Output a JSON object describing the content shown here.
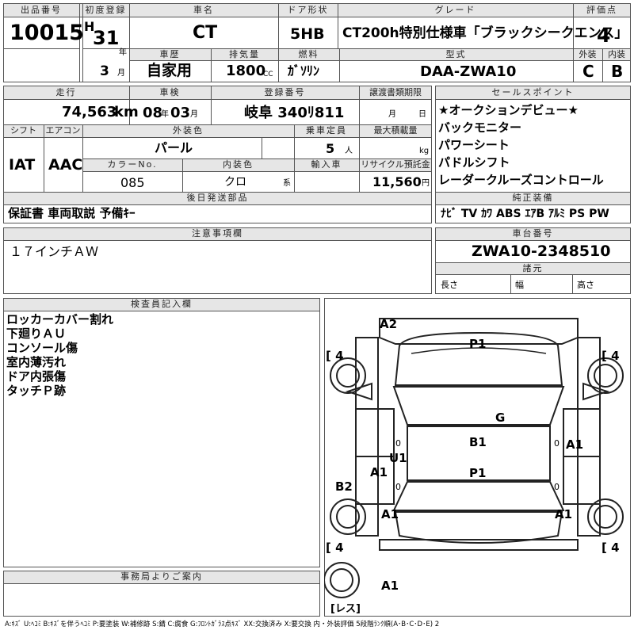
{
  "labels": {
    "lot": "出品番号",
    "first_reg": "初度登録",
    "car_name": "車名",
    "door": "ドア形状",
    "grade": "グレード",
    "score": "評価点",
    "history": "車歴",
    "displacement": "排気量",
    "fuel": "燃料",
    "model_code": "型式",
    "exterior": "外装",
    "interior": "内装",
    "mileage": "走行",
    "inspection": "車検",
    "registration": "登録番号",
    "transfer": "譲渡書類期限",
    "shift": "シフト",
    "ac": "エアコン",
    "ext_color": "外装色",
    "capacity": "乗車定員",
    "max_load": "最大積載量",
    "color_no": "カラーNo.",
    "int_color": "内装色",
    "import": "輸入車",
    "recycle": "リサイクル預託金",
    "later": "後日発送部品",
    "notes": "注意事項欄",
    "sales_point": "セールスポイント",
    "equipment": "純正装備",
    "chassis": "車台番号",
    "specs": "諸元",
    "length": "長さ",
    "width": "幅",
    "height": "高さ",
    "inspector": "検査員記入欄",
    "office": "事務局よりご案内",
    "year": "年",
    "month": "月",
    "cc": "CC",
    "km": "km",
    "kg": "kg",
    "yen": "円",
    "people": "人",
    "kei": "系",
    "ym_year": "年",
    "ym_month": "月"
  },
  "values": {
    "lot": "10015",
    "era": "H",
    "year": "31",
    "month": "3",
    "car_name": "CT",
    "door": "5HB",
    "grade": "CT200h特別仕様車「ブラックシークエンス」",
    "score": "4",
    "history": "自家用",
    "displacement": "1800",
    "fuel": "ｶﾞｿﾘﾝ",
    "model_code": "DAA-ZWA10",
    "exterior": "C",
    "interior": "B",
    "mileage": "74,563",
    "insp_year": "08",
    "insp_month": "03",
    "registration": "岐阜 340ﾘ811",
    "transfer_month": "月",
    "transfer_day": "日",
    "shift": "IAT",
    "ac": "AAC",
    "ext_color": "パール",
    "capacity": "5",
    "color_no": "085",
    "int_color": "クロ",
    "recycle": "11,560",
    "later": "保証書 車両取説 予備ｷｰ",
    "notes": "１７インチＡＷ",
    "equipment": "ﾅﾋﾞ TV ｶﾜ ABS ｴｱB ｱﾙﾐ PS PW",
    "chassis": "ZWA10-2348510"
  },
  "sales_points": [
    "★オークションデビュー★",
    "バックモニター",
    "パワーシート",
    "パドルシフト",
    "レーダークルーズコントロール"
  ],
  "inspector_notes": [
    "ロッカーカバー割れ",
    "下廻りＡＵ",
    "コンソール傷",
    "室内薄汚れ",
    "ドア内張傷",
    "タッチＰ跡"
  ],
  "diagram": {
    "marks": [
      "A2",
      "P1",
      "G",
      "B1",
      "U1",
      "A1",
      "P1",
      "B2",
      "A1",
      "A1",
      "A1",
      "A1"
    ],
    "tires": [
      "4",
      "4",
      "4",
      "4"
    ],
    "spare": "レス",
    "zero": "0"
  },
  "legend": "A:ｷｽﾞ U:ﾍｺﾐ B:ｷｽﾞを伴うﾍｺﾐ P:要塗装 W:補修跡 S:錆 C:腐食 G:ﾌﾛﾝﾄｶﾞﾗｽ点ｷｽﾞ XX:交換済み X:要交換 内・外装評価 5段階ﾗﾝｸ順(A･B･C･D･E) 2"
}
